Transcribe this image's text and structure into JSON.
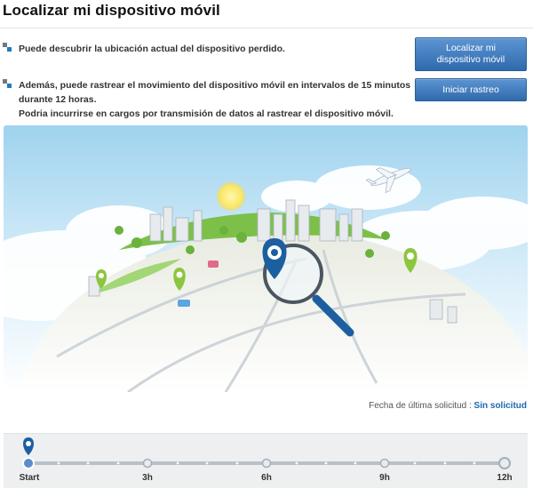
{
  "header": {
    "title": "Localizar mi dispositivo móvil"
  },
  "info": {
    "locate_text": "Puede descubrir la ubicación actual del dispositivo perdido.",
    "track_lines": [
      "Además, puede rastrear el movimiento del dispositivo móvil en intervalos de 15 minutos",
      "durante 12 horas.",
      "Podria incurrirse en cargos por transmisión de datos al rastrear el dispositivo móvil."
    ]
  },
  "buttons": {
    "locate_label": "Localizar mi dispositivo móvil",
    "track_label": "Iniciar rastreo"
  },
  "status": {
    "last_request_label": "Fecha de última solicitud :",
    "last_request_value": "Sin solicitud"
  },
  "timeline": {
    "labels": [
      "Start",
      "3h",
      "6h",
      "9h",
      "12h"
    ],
    "current_index": 0
  },
  "colors": {
    "accent": "#1b67ae",
    "button": "#3a76bb",
    "pin_blue": "#1b5fa0",
    "pin_green": "#8cc63f"
  }
}
